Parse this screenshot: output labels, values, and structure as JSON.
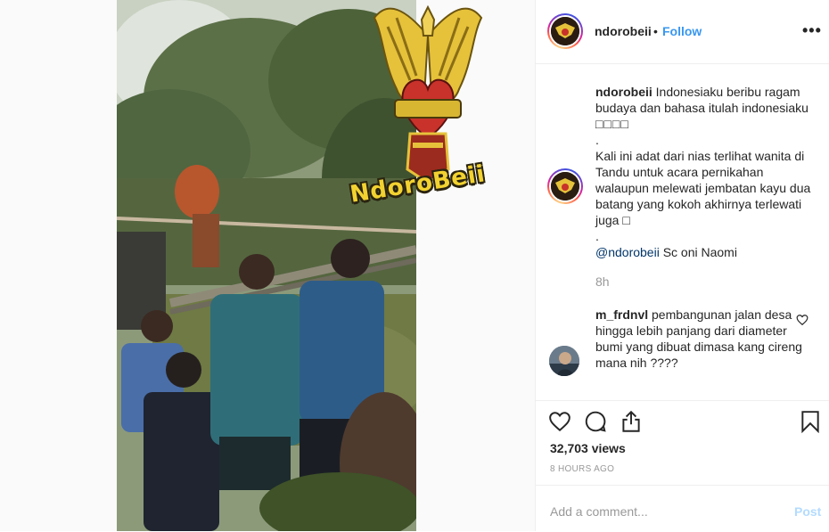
{
  "watermark": {
    "text": "NdoroBeii"
  },
  "post": {
    "username": "ndorobeii",
    "separator": "•",
    "follow_label": "Follow",
    "more_label": "•••",
    "caption": {
      "username": "ndorobeii",
      "line1": "Indonesiaku beribu ragam budaya dan bahasa itulah indonesiaku",
      "line1_symbols": "□□□□",
      "dot1": ".",
      "line2": "Kali ini adat dari nias terlihat wanita di Tandu untuk acara pernikahan walaupun melewati jembatan kayu dua batang yang kokoh akhirnya terlewati juga □",
      "dot2": ".",
      "mention": "@ndorobeii",
      "mention_rest": " Sc oni Naomi",
      "time": "8h"
    },
    "reply": {
      "username": "m_frdnvl",
      "text": "pembangunan jalan desa hingga lebih panjang dari diameter bumi yang dibuat dimasa kang cireng mana nih ????"
    },
    "views": "32,703 views",
    "posted": "8 HOURS AGO",
    "add_comment_placeholder": "Add a comment...",
    "post_label": "Post"
  },
  "icons": [
    "like-icon",
    "comment-icon",
    "share-icon",
    "save-icon",
    "more-icon",
    "small-heart-icon"
  ],
  "colors": {
    "link": "#3897f0",
    "text": "#262626",
    "muted": "#999999",
    "post_disabled": "#b3dbff",
    "watermark": "#f2d230"
  }
}
